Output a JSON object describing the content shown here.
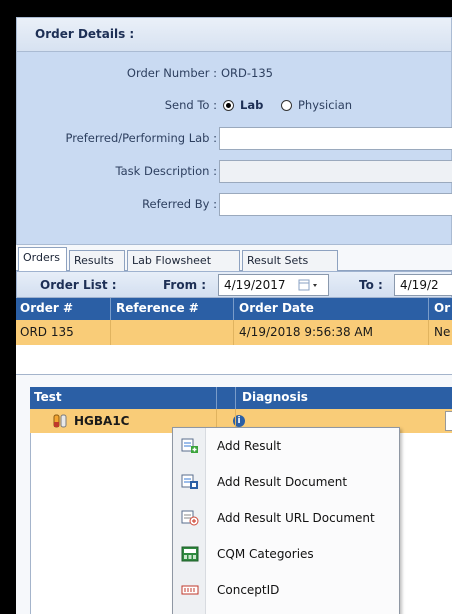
{
  "order_details": {
    "title": "Order Details :",
    "order_number_label": "Order Number :",
    "order_number_value": "ORD-135",
    "send_to_label": "Send To :",
    "send_to_options": [
      "Lab",
      "Physician"
    ],
    "send_to_selected": "Lab",
    "preferred_lab_label": "Preferred/Performing Lab :",
    "task_description_label": "Task Description :",
    "referred_by_label": "Referred By :"
  },
  "tabs": [
    "Orders",
    "Results",
    "Lab Flowsheet",
    "Result Sets"
  ],
  "active_tab": "Orders",
  "order_list": {
    "title": "Order List :",
    "from_label": "From :",
    "from_value": "4/19/2017",
    "to_label": "To :",
    "to_value": "4/19/2"
  },
  "orders_grid": {
    "columns": [
      "Order #",
      "Reference #",
      "Order Date",
      "Or"
    ],
    "rows": [
      {
        "order_no": "ORD 135",
        "reference": "",
        "order_date": "4/19/2018 9:56:38 AM",
        "extra": "Ne"
      }
    ]
  },
  "tests_grid": {
    "columns": [
      "Test",
      "Diagnosis"
    ],
    "rows": [
      {
        "test": "HGBA1C"
      }
    ]
  },
  "context_menu": {
    "items": [
      {
        "label": "Add Result",
        "icon": "add-result-icon"
      },
      {
        "label": "Add Result Document",
        "icon": "add-result-document-icon"
      },
      {
        "label": "Add Result URL Document",
        "icon": "add-result-url-document-icon"
      },
      {
        "label": "CQM Categories",
        "icon": "cqm-icon"
      },
      {
        "label": "ConceptID",
        "icon": "concept-id-icon"
      }
    ]
  },
  "colors": {
    "header_blue": "#2b5fa5",
    "selected_row": "#f9cc78",
    "panel_blue": "#c9daf2"
  }
}
